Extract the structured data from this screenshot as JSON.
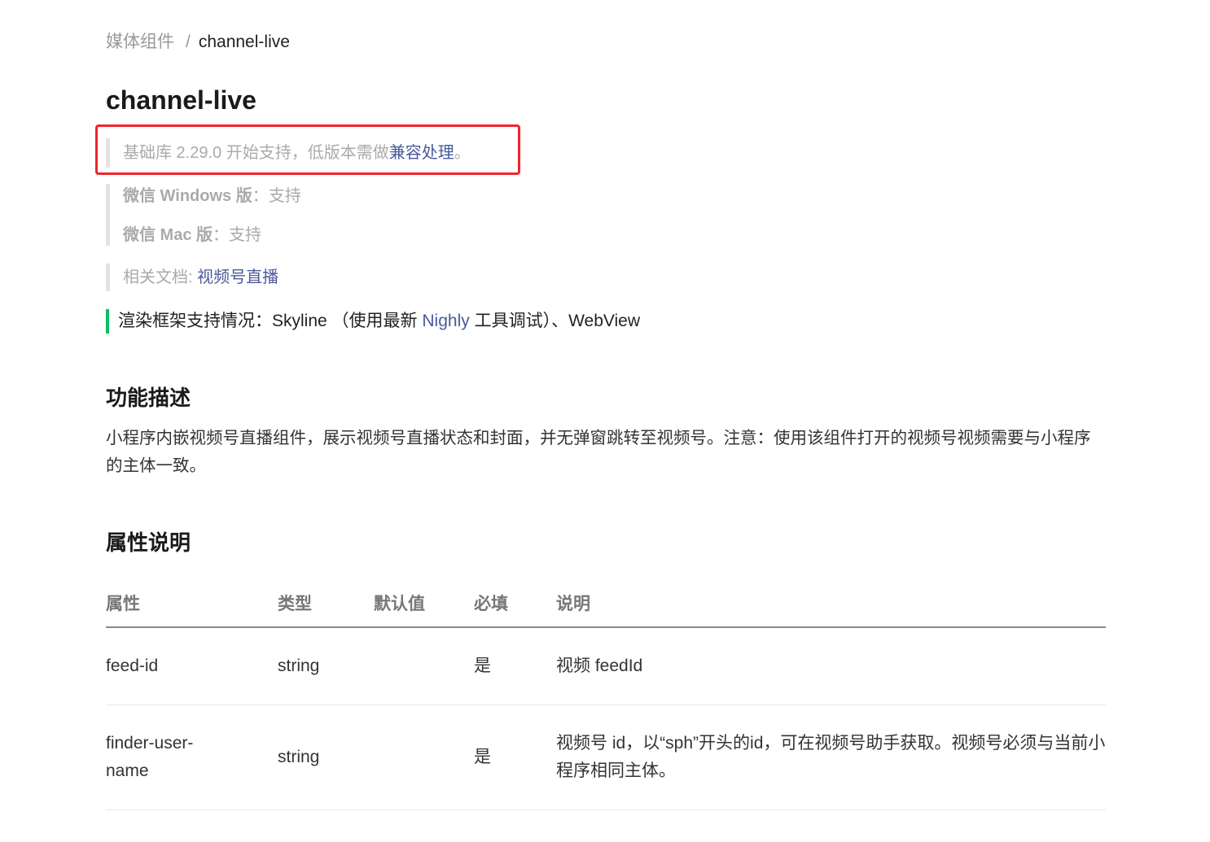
{
  "breadcrumb": {
    "parent": "媒体组件",
    "separator": "/",
    "current": "channel-live"
  },
  "page_title": "channel-live",
  "version_note": {
    "prefix": "基础库 2.29.0 开始支持，低版本需做",
    "link": "兼容处理",
    "suffix": "。"
  },
  "platform_support": [
    {
      "label": "微信 Windows 版",
      "value": "：支持"
    },
    {
      "label": "微信 Mac 版",
      "value": "：支持"
    }
  ],
  "related_docs": {
    "label": "相关文档: ",
    "link": "视频号直播"
  },
  "render_note": {
    "prefix": "渲染框架支持情况：Skyline （使用最新 ",
    "link": "Nighly",
    "suffix": " 工具调试）、WebView"
  },
  "section_desc": {
    "title": "功能描述",
    "text": "小程序内嵌视频号直播组件，展示视频号直播状态和封面，并无弹窗跳转至视频号。注意：使用该组件打开的视频号视频需要与小程序的主体一致。"
  },
  "section_attr": {
    "title": "属性说明"
  },
  "table": {
    "headers": [
      "属性",
      "类型",
      "默认值",
      "必填",
      "说明"
    ],
    "rows": [
      [
        "feed-id",
        "string",
        "",
        "是",
        "视频 feedId"
      ],
      [
        "finder-user-name",
        "string",
        "",
        "是",
        "视频号 id，以“sph”开头的id，可在视频号助手获取。视频号必须与当前小程序相同主体。"
      ]
    ]
  },
  "colors": {
    "link": "#4a5a9a",
    "accent_green": "#07c160",
    "highlight_red": "#f2252a"
  }
}
